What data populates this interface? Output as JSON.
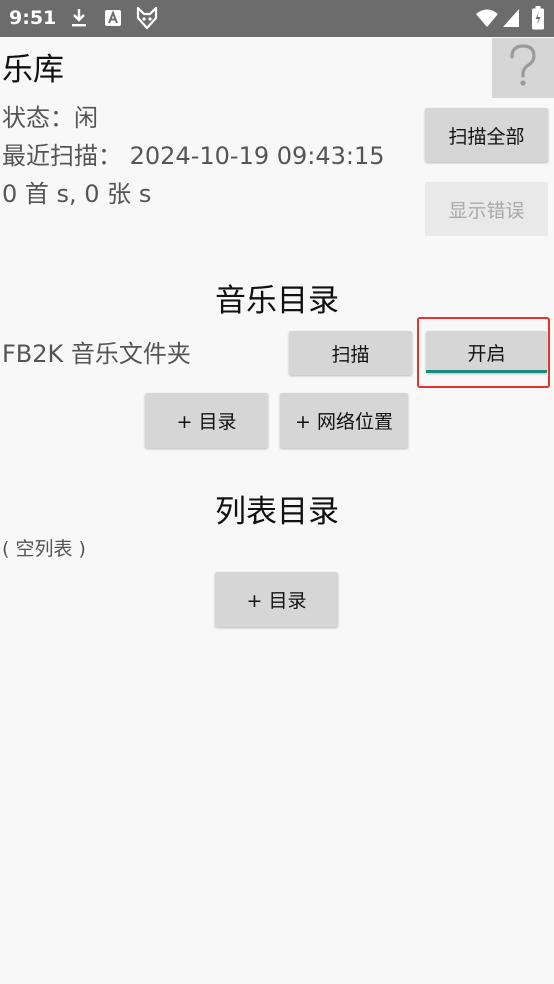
{
  "status_bar": {
    "time": "9:51",
    "icons": [
      "download-icon",
      "a-app-icon",
      "fox-app-icon",
      "wifi-icon",
      "signal-icon",
      "battery-icon"
    ]
  },
  "header": {
    "title": "乐库",
    "help_icon": "question-icon"
  },
  "library": {
    "status": "状态：闲",
    "last_scan": "最近扫描： 2024-10-19 09:43:15",
    "counts": "0 首  s, 0 张  s",
    "scan_all_label": "扫描全部",
    "show_errors_label": "显示错误"
  },
  "music_dirs": {
    "title": "音乐目录",
    "folder_name": "FB2K 音乐文件夹",
    "scan_label": "扫描",
    "enable_label": "开启",
    "add_dir_label": "+ 目录",
    "add_network_label": "+ 网络位置"
  },
  "list_dirs": {
    "title": "列表目录",
    "empty_label": "( 空列表 )",
    "add_dir_label": "+ 目录"
  },
  "colors": {
    "status_bar": "#6c6c6c",
    "background": "#f8f8f8",
    "button": "#d6d6d6",
    "accent": "#1a8a7e",
    "highlight": "#e2332c"
  }
}
